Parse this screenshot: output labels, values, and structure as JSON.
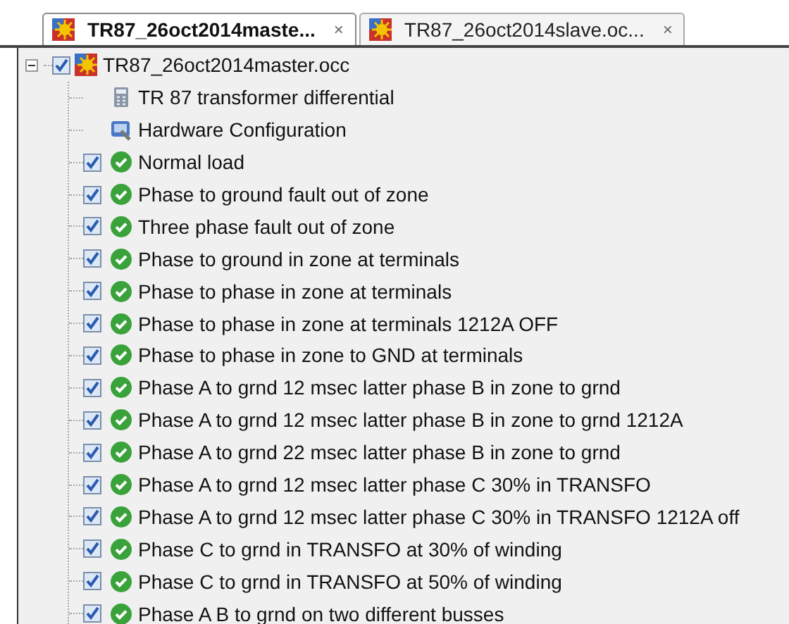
{
  "tabs": [
    {
      "label": "TR87_26oct2014maste...",
      "selected": true,
      "close": "×"
    },
    {
      "label": "TR87_26oct2014slave.oc...",
      "selected": false,
      "close": "×"
    }
  ],
  "tree": {
    "label": "TR87_26oct2014master.occ",
    "checked": true,
    "expanded": true,
    "children": [
      {
        "kind": "document",
        "label": "TR 87 transformer differential"
      },
      {
        "kind": "hardware",
        "label": "Hardware Configuration"
      },
      {
        "kind": "test",
        "label": "Normal load",
        "checked": true,
        "passed": true
      },
      {
        "kind": "test",
        "label": "Phase to ground fault out of zone",
        "checked": true,
        "passed": true
      },
      {
        "kind": "test",
        "label": "Three phase fault out of zone",
        "checked": true,
        "passed": true
      },
      {
        "kind": "test",
        "label": "Phase to ground in zone at terminals",
        "checked": true,
        "passed": true
      },
      {
        "kind": "test",
        "label": "Phase to phase in zone at terminals",
        "checked": true,
        "passed": true
      },
      {
        "kind": "test",
        "label": "Phase to phase in zone at terminals 1212A OFF",
        "checked": true,
        "passed": true
      },
      {
        "kind": "test",
        "label": "Phase to phase in zone to GND at terminals",
        "checked": true,
        "passed": true
      },
      {
        "kind": "test",
        "label": "Phase A to grnd 12 msec latter phase B in zone to grnd",
        "checked": true,
        "passed": true
      },
      {
        "kind": "test",
        "label": "Phase A to grnd 12 msec latter phase B in zone to grnd 1212A",
        "checked": true,
        "passed": true
      },
      {
        "kind": "test",
        "label": "Phase A to grnd 22 msec latter phase B in zone to grnd",
        "checked": true,
        "passed": true
      },
      {
        "kind": "test",
        "label": "Phase A to grnd 12 msec latter phase C 30% in TRANSFO",
        "checked": true,
        "passed": true
      },
      {
        "kind": "test",
        "label": "Phase A to grnd 12 msec latter phase C 30% in TRANSFO 1212A off",
        "checked": true,
        "passed": true
      },
      {
        "kind": "test",
        "label": "Phase C to grnd in TRANSFO at 30% of winding",
        "checked": true,
        "passed": true
      },
      {
        "kind": "test",
        "label": "Phase C to grnd in TRANSFO at 50% of winding",
        "checked": true,
        "passed": true
      },
      {
        "kind": "test",
        "label": "Phase A B to grnd on two different busses",
        "checked": true,
        "passed": true
      }
    ]
  }
}
